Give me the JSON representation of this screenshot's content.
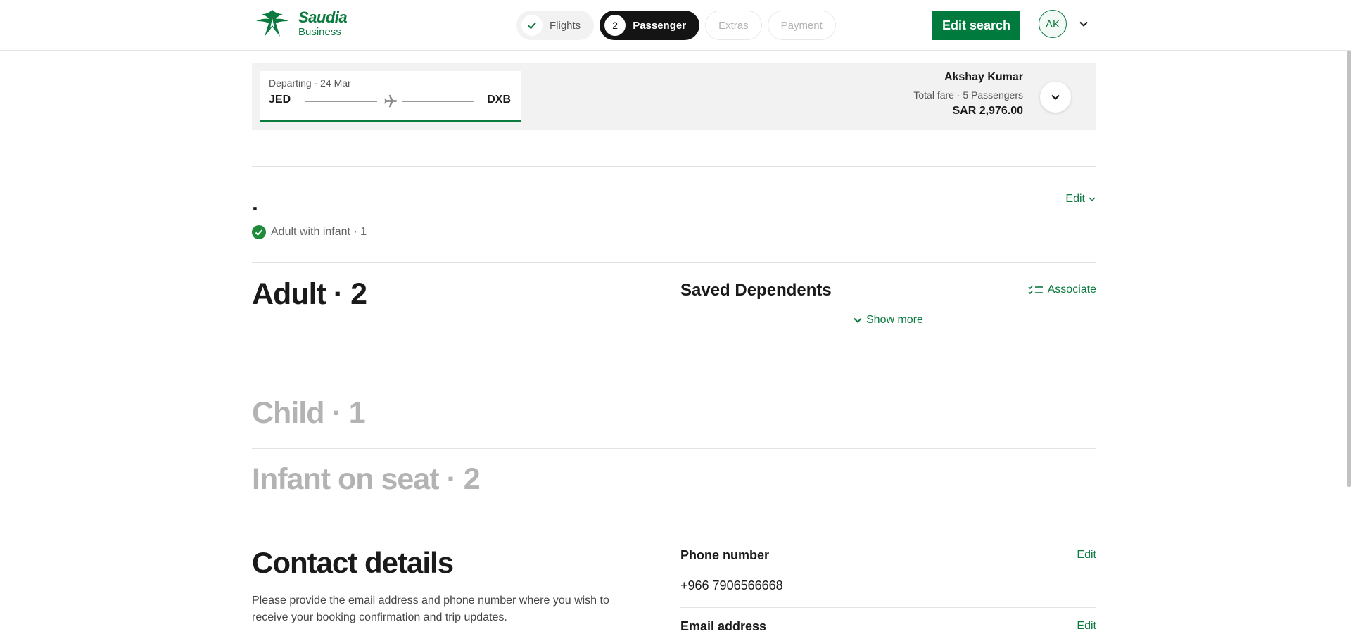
{
  "brand": {
    "name": "Saudia",
    "sub": "Business"
  },
  "steps": [
    {
      "label": "Flights",
      "state": "done"
    },
    {
      "number": "2",
      "label": "Passenger",
      "state": "active"
    },
    {
      "label": "Extras",
      "state": "todo"
    },
    {
      "label": "Payment",
      "state": "todo"
    }
  ],
  "header": {
    "edit_search": "Edit search",
    "avatar_initials": "AK"
  },
  "summary": {
    "departing": "Departing · 24 Mar",
    "from": "JED",
    "to": "DXB",
    "traveller": "Akshay Kumar",
    "fare_meta": "Total fare · 5 Passengers",
    "price": "SAR 2,976.00"
  },
  "section_top": {
    "title": ".",
    "edit": "Edit",
    "status": "Adult with infant · 1"
  },
  "adult": {
    "heading": "Adult · 2"
  },
  "dependents": {
    "title": "Saved Dependents",
    "associate": "Associate",
    "show_more": "Show more"
  },
  "child": {
    "heading": "Child · 1"
  },
  "infant": {
    "heading": "Infant on seat · 2"
  },
  "contact": {
    "heading": "Contact details",
    "description": "Please provide the email address and phone number where you wish to receive your booking confirmation and trip updates.",
    "phone_label": "Phone number",
    "phone_value": "+966 7906566668",
    "email_label": "Email address",
    "edit": "Edit"
  },
  "colors": {
    "brand_green": "#007a3d",
    "active_step": "#141414",
    "muted": "#b3b3b3"
  }
}
